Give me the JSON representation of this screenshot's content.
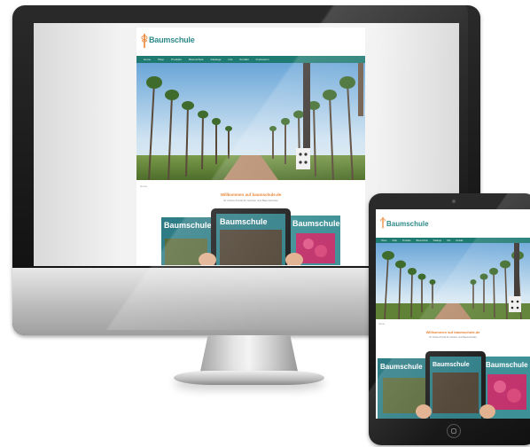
{
  "site": {
    "brand": "Baumschule",
    "nav": [
      "Home",
      "Shop",
      "Produkte",
      "Baumschule",
      "Kataloge",
      "Info",
      "Kontakt",
      "Impressum"
    ],
    "breadcrumb": "Home",
    "welcome": "Willkommen auf baumschule.de",
    "subline": "Ihr Online-Portal für Gärtner und Baumschulen",
    "magazine_title": "Baumschule"
  },
  "colors": {
    "accent_teal": "#1f7b72",
    "brand_teal": "#2f8a8a",
    "welcome_orange": "#e8751a"
  },
  "icons": {
    "logo": "tree-logo-icon",
    "home_button": "home-button-icon",
    "camera": "front-camera-icon"
  }
}
